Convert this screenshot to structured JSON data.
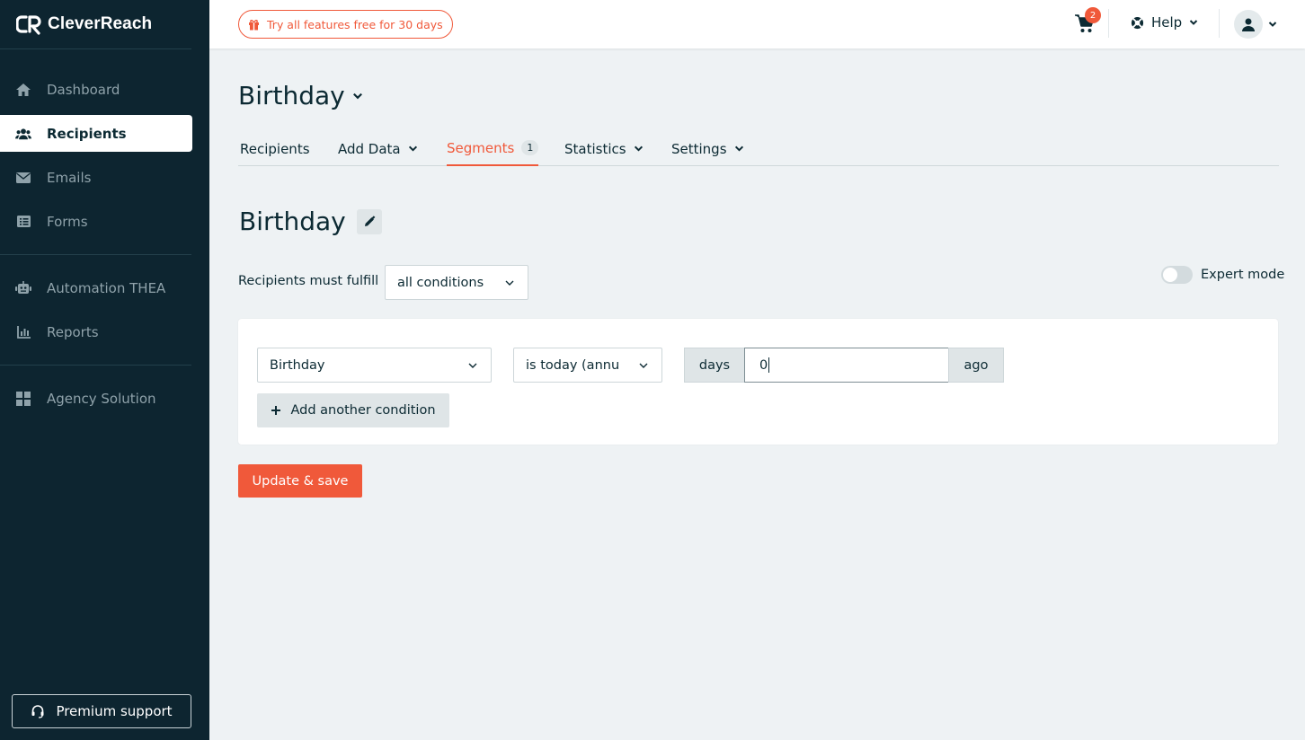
{
  "app": {
    "brand": "CleverReach"
  },
  "sidebar": {
    "items": [
      {
        "label": "Dashboard",
        "icon": "home-icon"
      },
      {
        "label": "Recipients",
        "icon": "users-icon",
        "active": true
      },
      {
        "label": "Emails",
        "icon": "envelope-icon"
      },
      {
        "label": "Forms",
        "icon": "form-icon"
      },
      {
        "label": "Automation THEA",
        "icon": "robot-icon"
      },
      {
        "label": "Reports",
        "icon": "chart-icon"
      },
      {
        "label": "Agency Solution",
        "icon": "grid-icon"
      }
    ],
    "premium_support": "Premium support"
  },
  "topbar": {
    "trial_label": "Try all features free for 30 days",
    "cart_count": "2",
    "help_label": "Help"
  },
  "page": {
    "group_title": "Birthday",
    "tabs": [
      {
        "label": "Recipients"
      },
      {
        "label": "Add Data"
      },
      {
        "label": "Segments",
        "badge": "1",
        "active": true
      },
      {
        "label": "Statistics"
      },
      {
        "label": "Settings"
      }
    ],
    "segment_title": "Birthday",
    "fulfill_label": "Recipients must fulfill",
    "fulfill_value": "all conditions",
    "expert_mode_label": "Expert mode",
    "expert_mode_on": false,
    "condition": {
      "field": "Birthday",
      "operator": "is today (annu",
      "prefix": "days",
      "value": "0",
      "suffix": "ago"
    },
    "add_condition_label": "Add another condition",
    "save_label": "Update & save"
  },
  "colors": {
    "accent": "#f0593a",
    "sidebar_bg": "#0d2530",
    "page_bg": "#eef2f4"
  }
}
